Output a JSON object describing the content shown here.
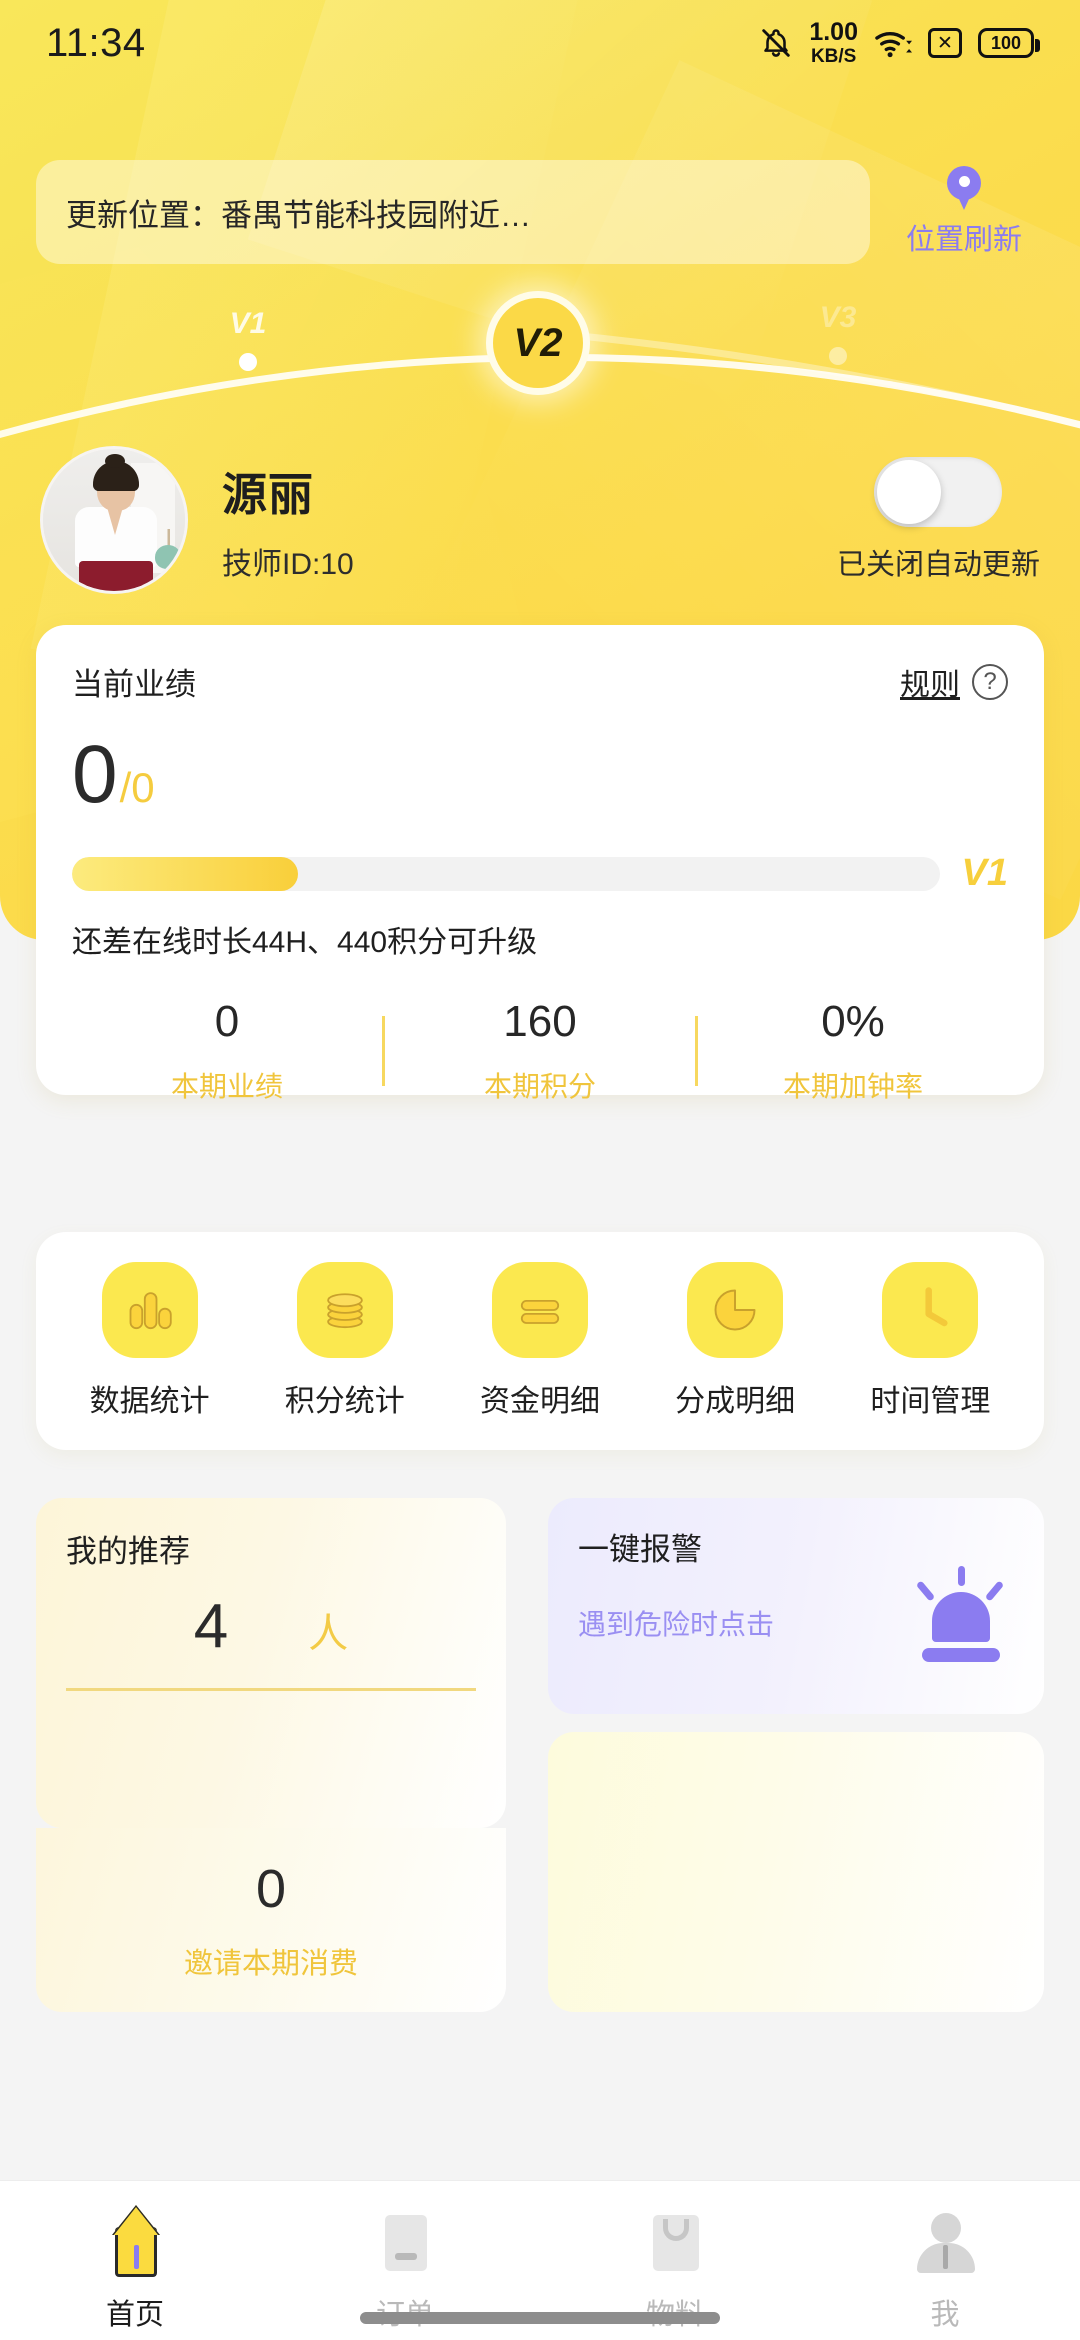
{
  "status_bar": {
    "time": "11:34",
    "network_speed_value": "1.00",
    "network_speed_unit": "KB/S",
    "sim_symbol": "✕",
    "battery_level": "100",
    "icons": [
      "bell-muted-icon",
      "wifi-icon",
      "sim-error-icon",
      "battery-icon"
    ]
  },
  "location": {
    "text": "更新位置：番禺节能科技园附近…",
    "refresh_label": "位置刷新",
    "refresh_color": "#8b7cf0"
  },
  "level_arc": {
    "prev": "V1",
    "current": "V2",
    "next": "V3"
  },
  "profile": {
    "name": "源丽",
    "id_text": "技师ID:10",
    "toggle_state": "off",
    "toggle_label": "已关闭自动更新"
  },
  "performance": {
    "title": "当前业绩",
    "rule_label": "规则",
    "help_icon": "?",
    "value": "0",
    "denominator": "/0",
    "progress_percent": 26,
    "progress_level": "V1",
    "hint": "还差在线时长44H、440积分可升级",
    "stats": [
      {
        "value": "0",
        "label": "本期业绩"
      },
      {
        "value": "160",
        "label": "本期积分"
      },
      {
        "value": "0%",
        "label": "本期加钟率"
      }
    ]
  },
  "shortcuts": [
    {
      "label": "数据统计",
      "icon": "bar-chart-icon"
    },
    {
      "label": "积分统计",
      "icon": "coins-stack-icon"
    },
    {
      "label": "资金明细",
      "icon": "list-lines-icon"
    },
    {
      "label": "分成明细",
      "icon": "pie-chart-icon"
    },
    {
      "label": "时间管理",
      "icon": "clock-icon"
    }
  ],
  "referral": {
    "title": "我的推荐",
    "count": "4",
    "unit": "人",
    "spend_value": "0",
    "spend_label": "邀请本期消费"
  },
  "alarm": {
    "title": "一键报警",
    "subtitle": "遇到危险时点击",
    "icon": "siren-icon",
    "accent_color": "#8b7cf0"
  },
  "bottom_nav": [
    {
      "label": "首页",
      "icon": "home-icon",
      "active": true
    },
    {
      "label": "订单",
      "icon": "order-icon",
      "active": false
    },
    {
      "label": "物料",
      "icon": "material-icon",
      "active": false
    },
    {
      "label": "我",
      "icon": "profile-icon",
      "active": false
    }
  ],
  "theme": {
    "brand_yellow": "#fbdb3f",
    "accent_purple": "#8b7cf0",
    "text_dark": "#1f1f1f",
    "label_gold": "#f0c53c"
  }
}
